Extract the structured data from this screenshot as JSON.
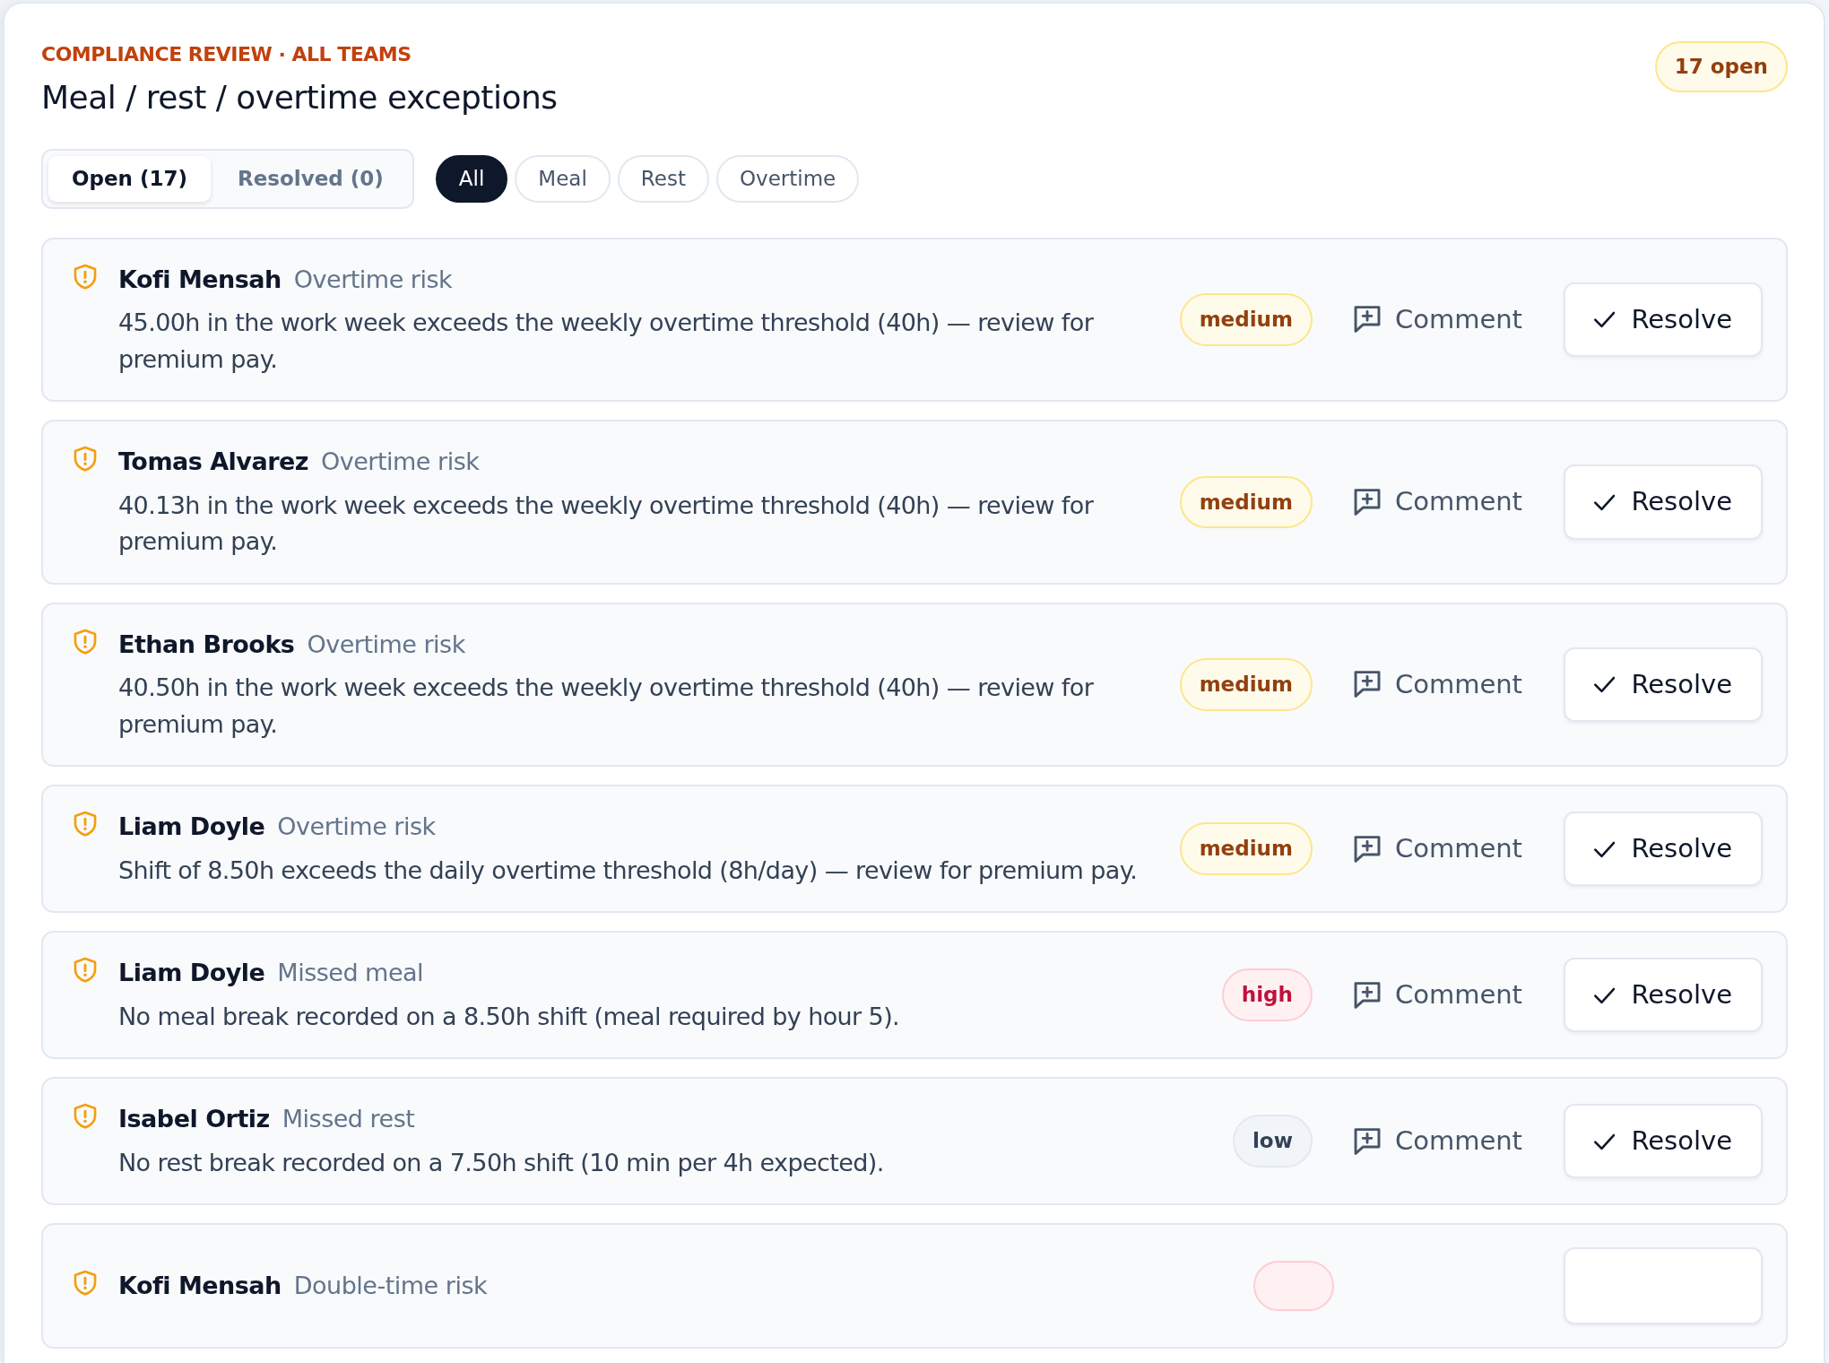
{
  "header": {
    "eyebrow": "COMPLIANCE REVIEW · ALL TEAMS",
    "title": "Meal / rest / overtime exceptions",
    "count_badge": "17 open"
  },
  "status_tabs": [
    {
      "label": "Open (17)",
      "selected": true
    },
    {
      "label": "Resolved (0)",
      "selected": false
    }
  ],
  "filters": [
    {
      "label": "All",
      "selected": true
    },
    {
      "label": "Meal",
      "selected": false
    },
    {
      "label": "Rest",
      "selected": false
    },
    {
      "label": "Overtime",
      "selected": false
    }
  ],
  "exceptions": [
    {
      "name": "Kofi Mensah",
      "type": "Overtime risk",
      "description": "45.00h in the work week exceeds the weekly overtime threshold (40h) — review for premium pay.",
      "severity": "medium",
      "comment": "Comment",
      "resolve": "Resolve"
    },
    {
      "name": "Tomas Alvarez",
      "type": "Overtime risk",
      "description": "40.13h in the work week exceeds the weekly overtime threshold (40h) — review for premium pay.",
      "severity": "medium",
      "comment": "Comment",
      "resolve": "Resolve"
    },
    {
      "name": "Ethan Brooks",
      "type": "Overtime risk",
      "description": "40.50h in the work week exceeds the weekly overtime threshold (40h) — review for premium pay.",
      "severity": "medium",
      "comment": "Comment",
      "resolve": "Resolve"
    },
    {
      "name": "Liam Doyle",
      "type": "Overtime risk",
      "description": "Shift of 8.50h exceeds the daily overtime threshold (8h/day) — review for premium pay.",
      "severity": "medium",
      "comment": "Comment",
      "resolve": "Resolve"
    },
    {
      "name": "Liam Doyle",
      "type": "Missed meal",
      "description": "No meal break recorded on a 8.50h shift (meal required by hour 5).",
      "severity": "high",
      "comment": "Comment",
      "resolve": "Resolve"
    },
    {
      "name": "Isabel Ortiz",
      "type": "Missed rest",
      "description": "No rest break recorded on a 7.50h shift (10 min per 4h expected).",
      "severity": "low",
      "comment": "Comment",
      "resolve": "Resolve"
    },
    {
      "name": "Kofi Mensah",
      "type": "Double-time risk",
      "color": "#fff1f2"
    }
  ]
}
